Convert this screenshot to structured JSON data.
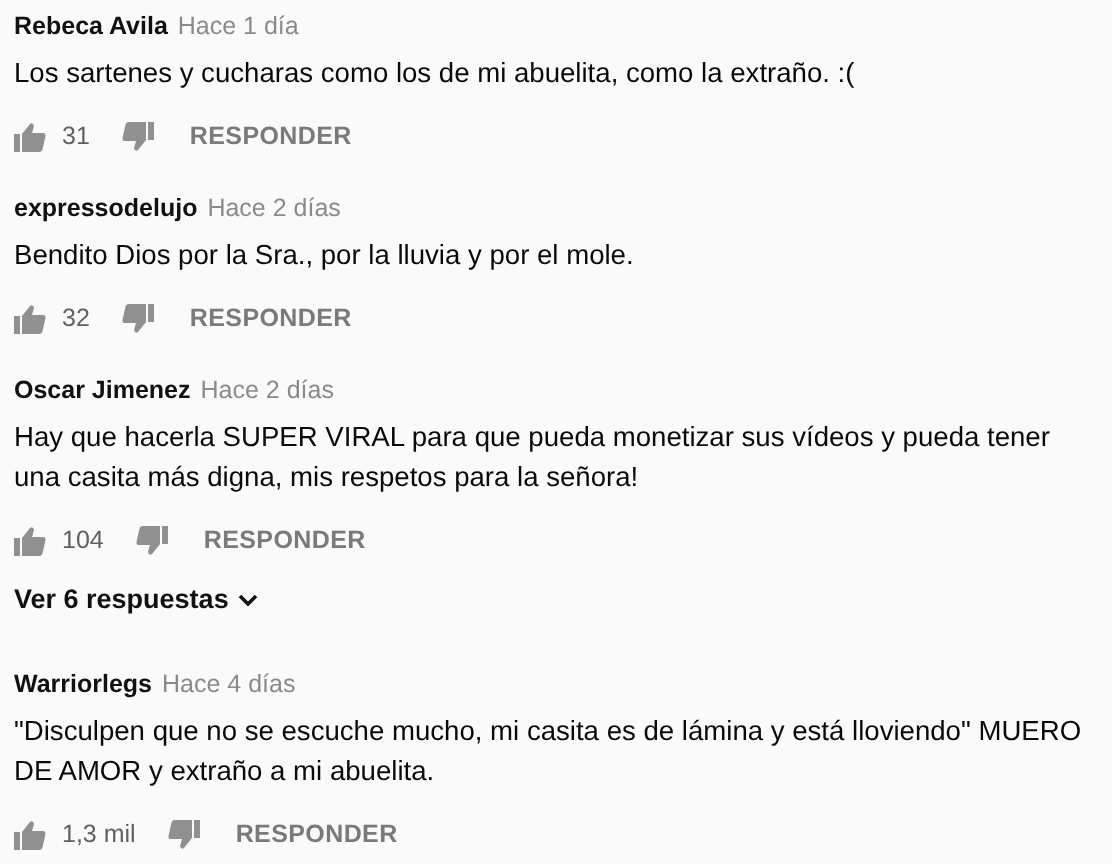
{
  "comments": [
    {
      "author": "Rebeca Avila",
      "time": "Hace 1 día",
      "text": "Los sartenes y cucharas como los de mi abuelita, como la extraño. :(",
      "likes": "31",
      "reply": "RESPONDER"
    },
    {
      "author": "expressodelujo",
      "time": "Hace 2 días",
      "text": "Bendito Dios por la Sra., por la lluvia y por el mole.",
      "likes": "32",
      "reply": "RESPONDER"
    },
    {
      "author": "Oscar Jimenez",
      "time": "Hace 2 días",
      "text": "Hay que hacerla SUPER VIRAL para que pueda monetizar sus vídeos y pueda tener una casita más digna, mis respetos para la señora!",
      "likes": "104",
      "reply": "RESPONDER",
      "replies_link": "Ver 6 respuestas"
    },
    {
      "author": "Warriorlegs",
      "time": "Hace 4 días",
      "text": "\"Disculpen que no se escuche mucho, mi casita es de lámina y está lloviendo\" MUERO DE AMOR y extraño a mi abuelita.",
      "likes": "1,3 mil",
      "reply": "RESPONDER"
    }
  ]
}
